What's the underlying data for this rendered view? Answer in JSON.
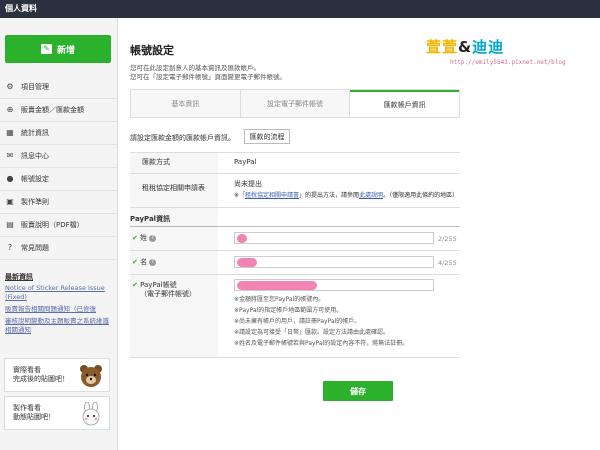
{
  "topbar": {
    "title": "個人資料"
  },
  "sidebar": {
    "new_button": "新增",
    "items": [
      {
        "icon": "gear-icon",
        "glyph": "⚙",
        "label": "項目管理"
      },
      {
        "icon": "cart-icon",
        "glyph": "⊕",
        "label": "販賣金額／匯款金額"
      },
      {
        "icon": "bar-chart-icon",
        "glyph": "▦",
        "label": "統計資訊"
      },
      {
        "icon": "mail-icon",
        "glyph": "✉",
        "label": "訊息中心"
      },
      {
        "icon": "user-icon",
        "glyph": "●",
        "label": "帳號設定"
      },
      {
        "icon": "book-icon",
        "glyph": "▣",
        "label": "製作準則"
      },
      {
        "icon": "pdf-icon",
        "glyph": "▤",
        "label": "販賣說明（PDF檔）"
      },
      {
        "icon": "question-icon",
        "glyph": "?",
        "label": "常見問題"
      }
    ],
    "news_title": "最新資訊",
    "news": [
      "Notice of Sticker Release Issue",
      "(Fixed)",
      "販賣報告相關問題通知（已修復",
      "審核說明變動及主題販賣之系統維護",
      "相關通知"
    ],
    "promos": [
      {
        "text": "實際看看\n完成後的貼圖吧！"
      },
      {
        "text": "製作看看\n動態貼圖吧！"
      }
    ]
  },
  "main": {
    "title": "帳號設定",
    "desc1": "您可在此設定創意人的基本資訊及匯款帳戶。",
    "desc2": "您可在「設定電子郵件帳號」頁面變更電子郵件帳號。",
    "logo": {
      "part1": "萱萱",
      "amp": "&",
      "part2": "迪迪",
      "url": "http://emily5543.pixnet.net/blog"
    },
    "tabs": [
      {
        "label": "基本資訊",
        "active": false
      },
      {
        "label": "設定電子郵件帳號",
        "active": false
      },
      {
        "label": "匯款帳戶資訊",
        "active": true
      }
    ],
    "intro": "請設定匯款金額的匯款帳戶資訊。",
    "flow_button": "匯款的流程",
    "method_label": "匯款方式",
    "method_value": "PayPal",
    "tax_label": "租稅協定相關申請表",
    "tax_value": "尚未提出",
    "tax_note_prefix": "※「",
    "tax_note_link": "租稅協定相關申請書",
    "tax_note_mid": "」的提出方法，請參閱",
    "tax_note_link2": "此處說明",
    "tax_note_suffix": "。（僅限適用此條約的地區）",
    "paypal_title": "PayPal資訊",
    "last_name_label": "姓",
    "last_name_count": "2/255",
    "first_name_label": "名",
    "first_name_count": "4/255",
    "paypal_label": "PayPal帳號",
    "paypal_label2": "（電子郵件帳號）",
    "notes": [
      "※金額將匯至您PayPal的帳號內。",
      "※PayPal的指定帳戶地區範圍方可使用。",
      "※尚未擁有帳戶的用戶，請註冊PayPal的帳戶。",
      "※請設定為可接受「日幣」匯款。設定方法請由此處確認。",
      "※姓名及電子郵件帳號若與PayPal的設定內容不符，將無法註冊。"
    ],
    "submit": "儲存"
  },
  "colors": {
    "accent": "#2bb12b",
    "topbar": "#2c3140",
    "pink": "#ee6ea8"
  }
}
